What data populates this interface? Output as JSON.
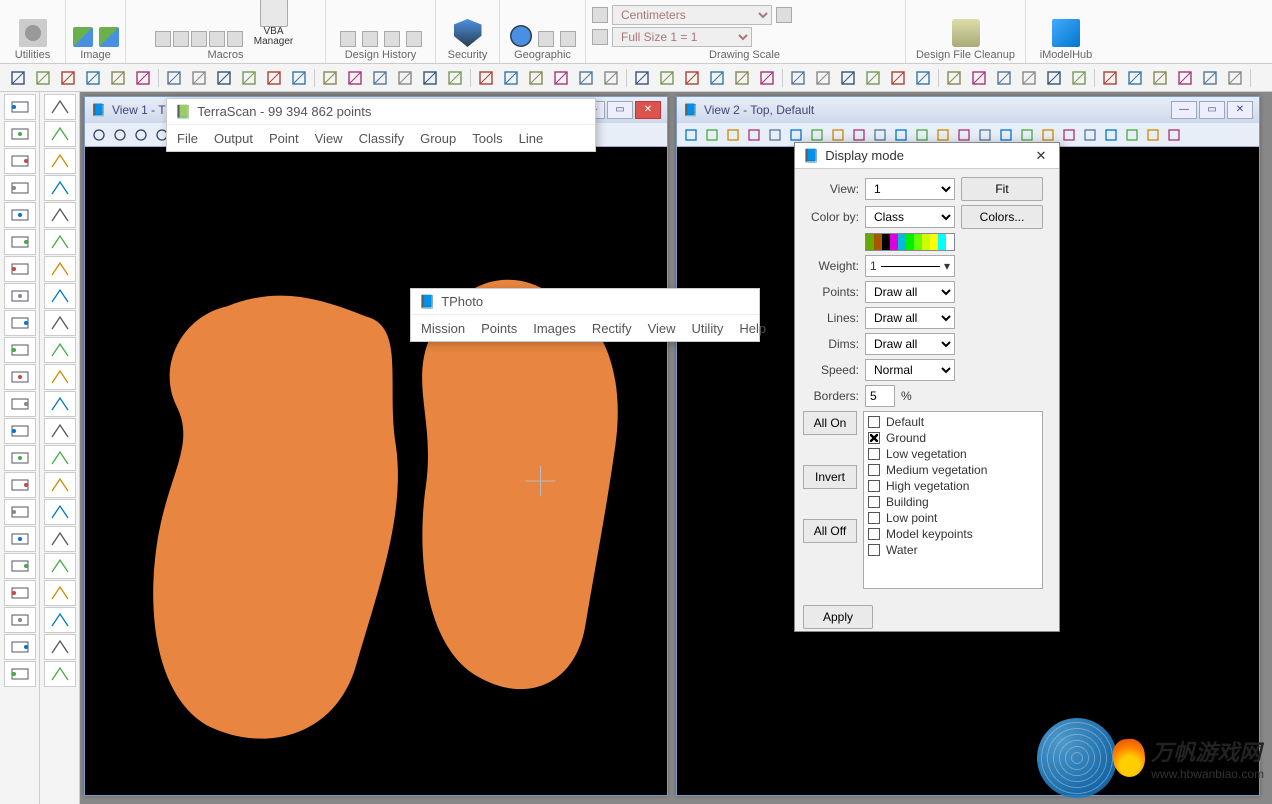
{
  "ribbon": {
    "groups": {
      "utilities": "Utilities",
      "image": "Image",
      "macros": "Macros",
      "vba_manager": "VBA\nManager",
      "design_history": "Design History",
      "security": "Security",
      "geographic": "Geographic",
      "drawing_scale": "Drawing Scale",
      "design_file_cleanup": "Design File Cleanup",
      "imodelhub": "iModelHub"
    },
    "scale": {
      "unit": "Centimeters",
      "value": "Full Size 1 = 1"
    }
  },
  "view1": {
    "title": "View 1 - T"
  },
  "view2": {
    "title": "View 2 - Top, Default"
  },
  "terrascan": {
    "title": "TerraScan - 99 394 862 points",
    "menu": [
      "File",
      "Output",
      "Point",
      "View",
      "Classify",
      "Group",
      "Tools",
      "Line"
    ]
  },
  "tphoto": {
    "title": "TPhoto",
    "menu": [
      "Mission",
      "Points",
      "Images",
      "Rectify",
      "View",
      "Utility",
      "Help"
    ]
  },
  "display_mode": {
    "title": "Display mode",
    "labels": {
      "view": "View:",
      "color_by": "Color by:",
      "weight": "Weight:",
      "points": "Points:",
      "lines": "Lines:",
      "dims": "Dims:",
      "speed": "Speed:",
      "borders": "Borders:",
      "borders_pct": "%"
    },
    "values": {
      "view": "1",
      "color_by": "Class",
      "weight": "1",
      "points": "Draw all",
      "lines": "Draw all",
      "dims": "Draw all",
      "speed": "Normal",
      "borders": "5"
    },
    "buttons": {
      "fit": "Fit",
      "colors": "Colors...",
      "all_on": "All On",
      "invert": "Invert",
      "all_off": "All Off",
      "apply": "Apply"
    },
    "classes": [
      {
        "label": "Default",
        "checked": false
      },
      {
        "label": "Ground",
        "checked": true
      },
      {
        "label": "Low vegetation",
        "checked": false
      },
      {
        "label": "Medium vegetation",
        "checked": false
      },
      {
        "label": "High vegetation",
        "checked": false
      },
      {
        "label": "Building",
        "checked": false
      },
      {
        "label": "Low point",
        "checked": false
      },
      {
        "label": "Model keypoints",
        "checked": false
      },
      {
        "label": "Water",
        "checked": false
      }
    ],
    "color_strip": [
      "#6a0",
      "#a50",
      "#000",
      "#d0d",
      "#0bd",
      "#0e0",
      "#6f0",
      "#cf0",
      "#ff0",
      "#0ff",
      "#fff"
    ]
  },
  "watermark": {
    "brand": "万帆游戏网",
    "domain": "www.hbwanbiao.com"
  }
}
